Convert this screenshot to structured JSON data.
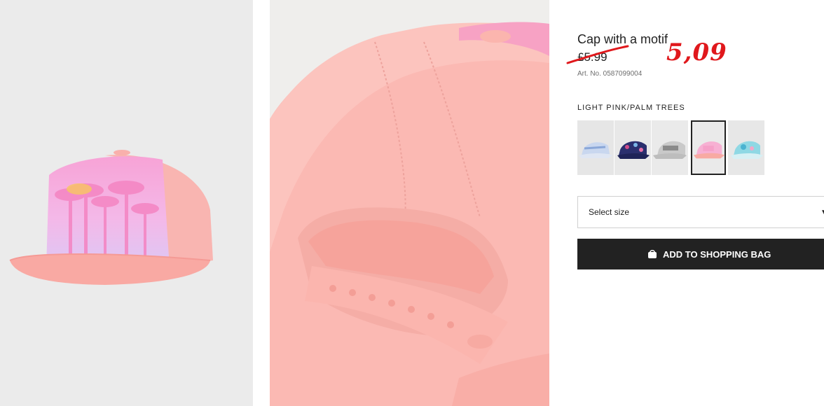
{
  "product": {
    "title": "Cap with a motif",
    "old_price": "£5.99",
    "new_price": "5,09",
    "article_number": "Art. No. 0587099004",
    "color_name": "LIGHT PINK/PALM TREES"
  },
  "swatches": [
    {
      "name": "blue-white-cap",
      "selected": false
    },
    {
      "name": "navy-print-cap",
      "selected": false
    },
    {
      "name": "grey-nyc-cap",
      "selected": false
    },
    {
      "name": "light-pink-palm-trees-cap",
      "selected": true
    },
    {
      "name": "turquoise-print-cap",
      "selected": false
    }
  ],
  "size_select": {
    "label": "Select size"
  },
  "add_button": {
    "label": "ADD TO SHOPPING BAG"
  },
  "colors": {
    "accent_red": "#e0181c",
    "button_dark": "#222222",
    "cap_pink": "#f8b8b4"
  },
  "icons": [
    "chevron-down-icon",
    "shopping-bag-icon"
  ]
}
